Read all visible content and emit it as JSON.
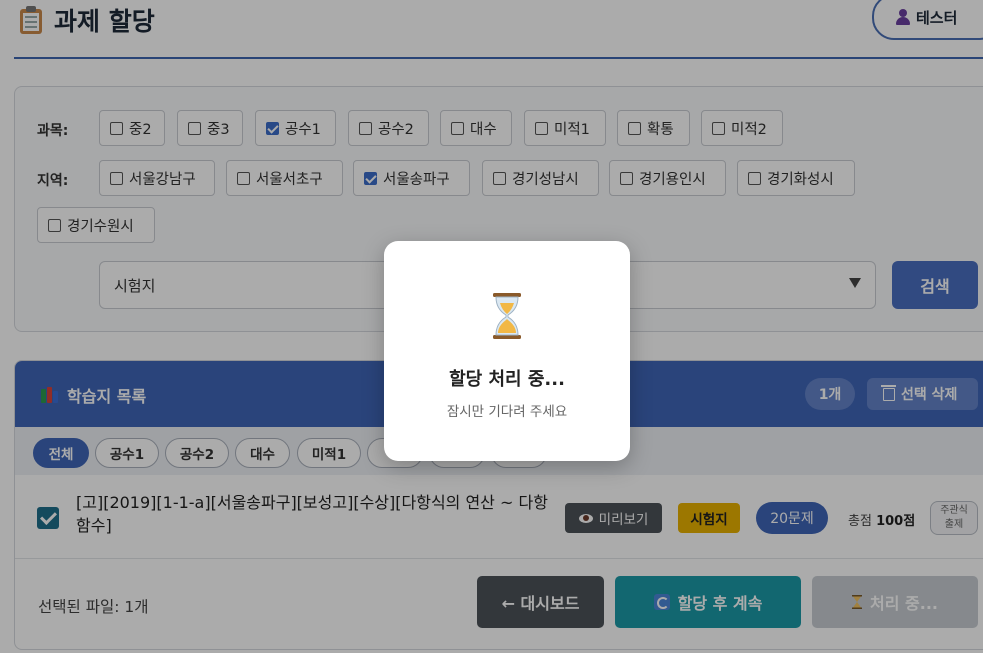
{
  "header": {
    "title": "과제 할당",
    "user_name": "테스터"
  },
  "filters": {
    "subject_label": "과목:",
    "subjects": [
      {
        "label": "중2",
        "checked": false
      },
      {
        "label": "중3",
        "checked": false
      },
      {
        "label": "공수1",
        "checked": true
      },
      {
        "label": "공수2",
        "checked": false
      },
      {
        "label": "대수",
        "checked": false
      },
      {
        "label": "미적1",
        "checked": false
      },
      {
        "label": "확통",
        "checked": false
      },
      {
        "label": "미적2",
        "checked": false
      }
    ],
    "region_label": "지역:",
    "regions": [
      {
        "label": "서울강남구",
        "checked": false
      },
      {
        "label": "서울서초구",
        "checked": false
      },
      {
        "label": "서울송파구",
        "checked": true
      },
      {
        "label": "경기성남시",
        "checked": false
      },
      {
        "label": "경기용인시",
        "checked": false
      },
      {
        "label": "경기화성시",
        "checked": false
      },
      {
        "label": "경기수원시",
        "checked": false
      }
    ],
    "type_select_value": "시험지",
    "search_label": "검색"
  },
  "list": {
    "title": "학습지 목록",
    "count": "1개",
    "delete_label": "선택 삭제",
    "tabs": [
      "전체",
      "공수1",
      "공수2",
      "대수",
      "미적1",
      "확",
      "",
      ""
    ],
    "active_tab": "전체",
    "rows": [
      {
        "checked": true,
        "name": "[고][2019][1-1-a][서울송파구][보성고][수상][다항식의 연산 ~ 다항함수]",
        "preview_label": "미리보기",
        "type": "시험지",
        "questions": "20문제",
        "score_prefix": "총점",
        "score": "100점",
        "subjective_line1": "주관식",
        "subjective_line2": "출제"
      }
    ]
  },
  "footer": {
    "selected_files": "선택된 파일: 1개",
    "dashboard_label": "← 대시보드",
    "assign_label": "할당 후 계속",
    "processing_label": "처리 중..."
  },
  "modal": {
    "title": "할당 처리 중...",
    "subtitle": "잠시만 기다려 주세요"
  },
  "colors": {
    "primary": "#3f66b8",
    "teal": "#1b9aa8",
    "badge_yellow": "#e9b200",
    "dark_gray": "#4c5258"
  }
}
